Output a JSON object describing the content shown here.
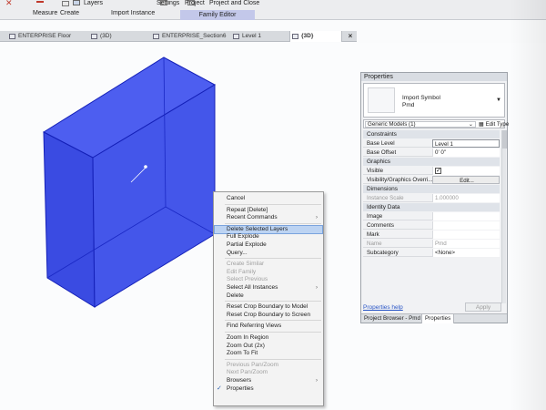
{
  "ribbon": {
    "items": [
      "Measure",
      "Create",
      "Layers",
      "Settings",
      "Project",
      "Project and Close"
    ],
    "groups": [
      "Import Instance"
    ],
    "context_tab": "Family Editor"
  },
  "view_tabs": [
    {
      "label": "ENTERPRISE Floor",
      "icon": "floor-plan-icon"
    },
    {
      "label": "(3D)",
      "icon": "3d-view-icon"
    },
    {
      "label": "ENTERPRISE_Section6",
      "icon": "section-icon"
    },
    {
      "label": "Level 1",
      "icon": "floor-plan-icon"
    },
    {
      "label": "{3D}",
      "icon": "3d-view-icon",
      "active": true
    }
  ],
  "tab_close": "×",
  "context_menu": {
    "items": [
      {
        "label": "Cancel"
      },
      {
        "sep": true
      },
      {
        "label": "Repeat [Delete]"
      },
      {
        "label": "Recent Commands",
        "submenu": true
      },
      {
        "sep": true
      },
      {
        "label": "Delete Selected Layers",
        "highlight": true
      },
      {
        "label": "Full Explode"
      },
      {
        "label": "Partial Explode"
      },
      {
        "label": "Query..."
      },
      {
        "sep": true
      },
      {
        "label": "Create Similar",
        "disabled": true
      },
      {
        "label": "Edit Family",
        "disabled": true
      },
      {
        "label": "Select Previous",
        "disabled": true
      },
      {
        "label": "Select All Instances",
        "submenu": true
      },
      {
        "label": "Delete"
      },
      {
        "sep": true
      },
      {
        "label": "Reset Crop Boundary to Model"
      },
      {
        "label": "Reset Crop Boundary to Screen"
      },
      {
        "sep": true
      },
      {
        "label": "Find Referring Views"
      },
      {
        "sep": true
      },
      {
        "label": "Zoom In Region"
      },
      {
        "label": "Zoom Out (2x)"
      },
      {
        "label": "Zoom To Fit"
      },
      {
        "sep": true
      },
      {
        "label": "Previous Pan/Zoom",
        "disabled": true
      },
      {
        "label": "Next Pan/Zoom",
        "disabled": true
      },
      {
        "label": "Browsers",
        "submenu": true
      },
      {
        "label": "Properties",
        "checked": true
      }
    ]
  },
  "properties": {
    "title": "Properties",
    "type_name_line1": "Import Symbol",
    "type_name_line2": "Pmd",
    "selection": "Generic Models (1)",
    "edit_type": "Edit Type",
    "rows": [
      {
        "section": "Constraints"
      },
      {
        "key": "Base Level",
        "value": "Level 1",
        "kind": "input"
      },
      {
        "key": "Base Offset",
        "value": "0'  0\""
      },
      {
        "section": "Graphics"
      },
      {
        "key": "Visible",
        "value": "",
        "kind": "check"
      },
      {
        "key": "Visibility/Graphics Overri...",
        "value": "Edit...",
        "kind": "button"
      },
      {
        "section": "Dimensions"
      },
      {
        "key": "Instance Scale",
        "value": "1.000000",
        "disabled": true
      },
      {
        "section": "Identity Data"
      },
      {
        "key": "Image",
        "value": ""
      },
      {
        "key": "Comments",
        "value": ""
      },
      {
        "key": "Mark",
        "value": ""
      },
      {
        "key": "Name",
        "value": "Pmd",
        "disabled": true
      },
      {
        "key": "Subcategory",
        "value": "<None>"
      }
    ],
    "help_link": "Properties help",
    "apply": "Apply",
    "bottom_tabs": [
      "Project Browser - Pmd",
      "Properties"
    ]
  },
  "colors": {
    "model_fill": "#3d4ee6",
    "model_edge": "#1420b8",
    "highlight": "#bcd3f2",
    "context_tab": "#c3c8ea"
  }
}
